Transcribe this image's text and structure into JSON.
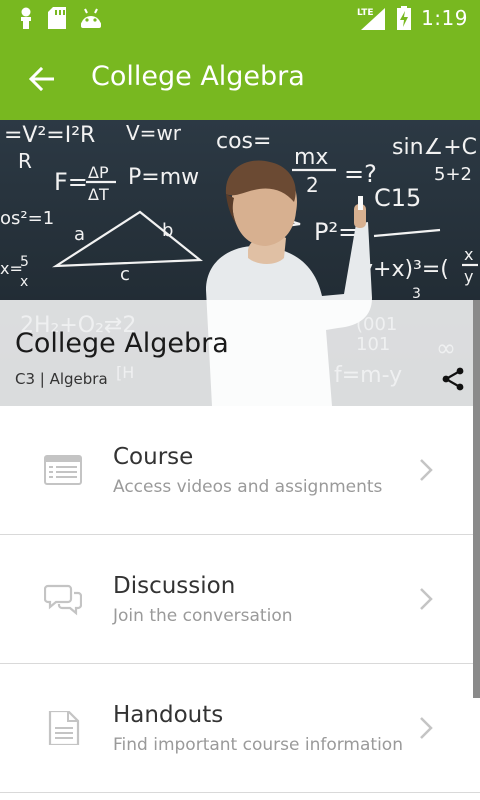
{
  "status_bar": {
    "time": "1:19",
    "network": "LTE",
    "icons": [
      "person-icon",
      "sd-card-icon",
      "android-icon",
      "signal-icon",
      "battery-charging-icon"
    ]
  },
  "app_bar": {
    "title": "College Algebra",
    "back_icon": "arrow-left-icon"
  },
  "hero": {
    "title": "College Algebra",
    "subtitle": "C3 | Algebra",
    "share_icon": "share-icon"
  },
  "menu": {
    "items": [
      {
        "title": "Course",
        "description": "Access videos and assignments",
        "icon": "list-icon"
      },
      {
        "title": "Discussion",
        "description": "Join the conversation",
        "icon": "chat-bubbles-icon"
      },
      {
        "title": "Handouts",
        "description": "Find important course information",
        "icon": "document-icon"
      }
    ]
  },
  "colors": {
    "primary": "#78b820",
    "text_primary": "#333333",
    "text_secondary": "#9a9a9a",
    "divider": "#d9d9d9"
  }
}
